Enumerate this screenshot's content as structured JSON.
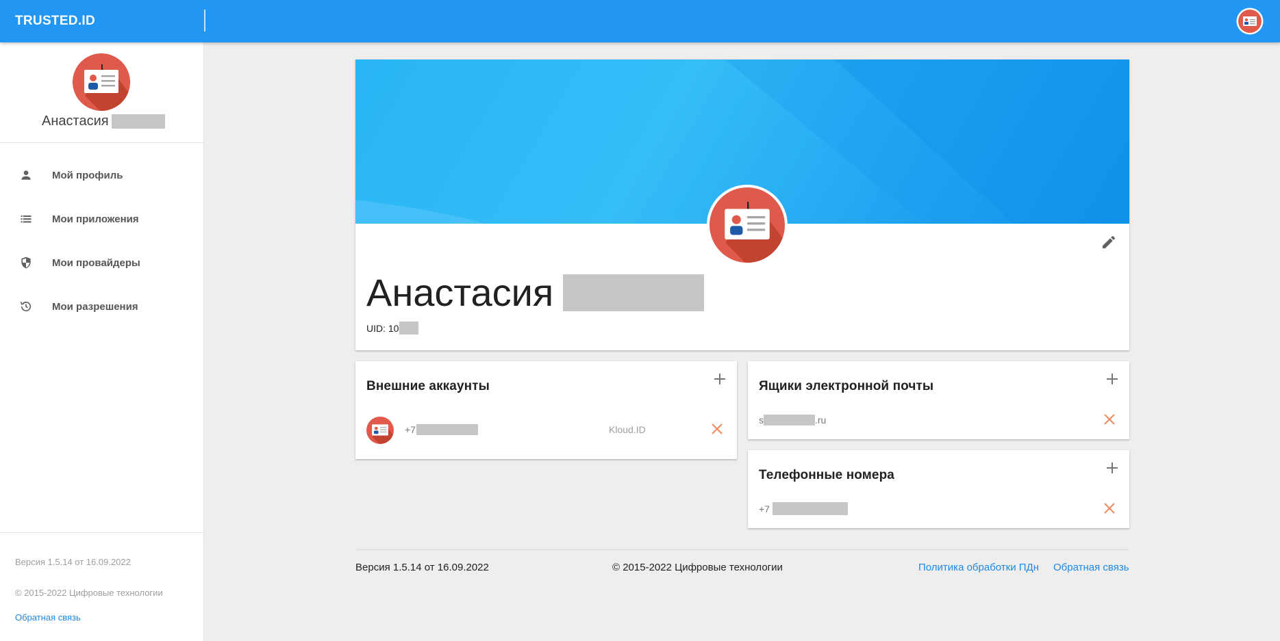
{
  "app": {
    "brand": "TRUSTED.ID"
  },
  "sidebar": {
    "user_name": "Анастасия",
    "nav": [
      {
        "label": "Мой профиль",
        "icon": "person-icon"
      },
      {
        "label": "Мои приложения",
        "icon": "list-icon"
      },
      {
        "label": "Мои провайдеры",
        "icon": "shield-icon"
      },
      {
        "label": "Мои разрешения",
        "icon": "history-icon"
      }
    ],
    "version": "Версия 1.5.14 от 16.09.2022",
    "copyright": "© 2015-2022 Цифровые технологии",
    "feedback": "Обратная связь"
  },
  "profile": {
    "name": "Анастасия",
    "uid": "UID: 10"
  },
  "external_accounts": {
    "title": "Внешние аккаунты",
    "items": [
      {
        "value": "+7",
        "provider": "Kloud.ID"
      }
    ]
  },
  "emails": {
    "title": "Ящики электронной почты",
    "items": [
      {
        "prefix": "s",
        "suffix": ".ru"
      }
    ]
  },
  "phones": {
    "title": "Телефонные номера",
    "items": [
      {
        "value": "+7"
      }
    ]
  },
  "footer": {
    "version": "Версия 1.5.14 от 16.09.2022",
    "copyright": "© 2015-2022 Цифровые технологии",
    "privacy": "Политика обработки ПДн",
    "feedback": "Обратная связь"
  },
  "colors": {
    "primary": "#2196f3",
    "avatar": "#e05a4b",
    "remove": "#f08a5d",
    "link": "#1e88e5"
  }
}
